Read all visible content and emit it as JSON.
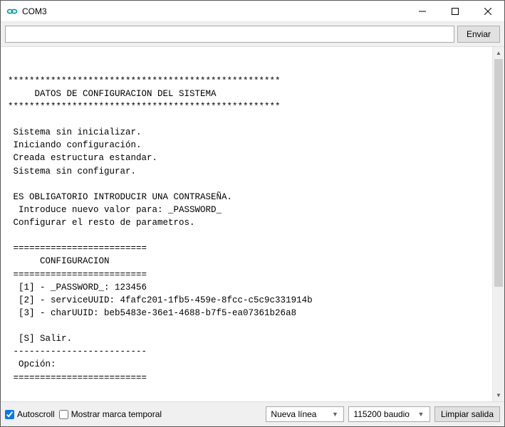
{
  "window": {
    "title": "COM3"
  },
  "input": {
    "value": "",
    "placeholder": "",
    "send_label": "Enviar"
  },
  "output_lines": [
    "",
    "***************************************************",
    "     DATOS DE CONFIGURACION DEL SISTEMA",
    "***************************************************",
    "",
    " Sistema sin inicializar.",
    " Iniciando configuración.",
    " Creada estructura estandar.",
    " Sistema sin configurar.",
    "",
    " ES OBLIGATORIO INTRODUCIR UNA CONTRASEÑA.",
    "  Introduce nuevo valor para: _PASSWORD_",
    " Configurar el resto de parametros.",
    "",
    " =========================",
    "      CONFIGURACION",
    " =========================",
    "  [1] - _PASSWORD_: 123456",
    "  [2] - serviceUUID: 4fafc201-1fb5-459e-8fcc-c5c9c331914b",
    "  [3] - charUUID: beb5483e-36e1-4688-b7f5-ea07361b26a8",
    "",
    "  [S] Salir.",
    " -------------------------",
    "  Opción:",
    " ========================="
  ],
  "bottom": {
    "autoscroll_label": "Autoscroll",
    "autoscroll_checked": true,
    "timestamp_label": "Mostrar marca temporal",
    "timestamp_checked": false,
    "line_ending_selected": "Nueva línea",
    "baud_selected": "115200 baudio",
    "clear_label": "Limpiar salida"
  }
}
